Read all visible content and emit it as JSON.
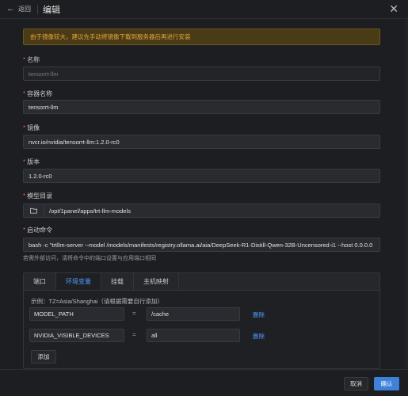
{
  "header": {
    "back_icon": "arrow-left-icon",
    "back_label": "返回",
    "title": "编辑",
    "close_icon": "close-icon"
  },
  "alert": {
    "text": "由于镜像较大，建议先手动将镜像下载到服务器后再进行安装",
    "color": "#e7a43c"
  },
  "form": {
    "name": {
      "label": "名称",
      "value": "tensorrt-llm"
    },
    "container_name": {
      "label": "容器名称",
      "value": "tensorrt-llm"
    },
    "image": {
      "label": "镜像",
      "value": "nvcr.io/nvidia/tensorrt-llm:1.2.0-rc0"
    },
    "version": {
      "label": "版本",
      "value": "1.2.0-rc0"
    },
    "model_dir": {
      "label": "模型目录",
      "value": "/opt/1panel/apps/trt-llm-models",
      "icon": "folder-icon"
    },
    "start_cmd": {
      "label": "启动命令",
      "value": "bash -c \"trtllm-server --model /models/manifests/registry.ollama.ai/aia/DeepSeek-R1-Distill-Qwen-32B-Uncensored-i1 --host 0.0.0.0"
    },
    "hint": "若需外部访问，请将命令中的端口设置与应用端口相同"
  },
  "tabs": [
    {
      "label": "端口",
      "active": false
    },
    {
      "label": "环境变量",
      "active": true
    },
    {
      "label": "挂载",
      "active": false
    },
    {
      "label": "主机映射",
      "active": false
    }
  ],
  "env": {
    "example": "示例：TZ=Asia/Shanghai（请根据需要自行添加）",
    "equals": "=",
    "rows": [
      {
        "key": "MODEL_PATH",
        "value": "/cache",
        "delete_label": "删除"
      },
      {
        "key": "NVIDIA_VISIBLE_DEVICES",
        "value": "all",
        "delete_label": "删除"
      }
    ],
    "add_label": "添加"
  },
  "footer": {
    "cancel_label": "取消",
    "confirm_label": "确认"
  },
  "colors": {
    "accent": "#4c9cff",
    "primary_button": "#3d82d8",
    "required": "#e25a5a"
  }
}
